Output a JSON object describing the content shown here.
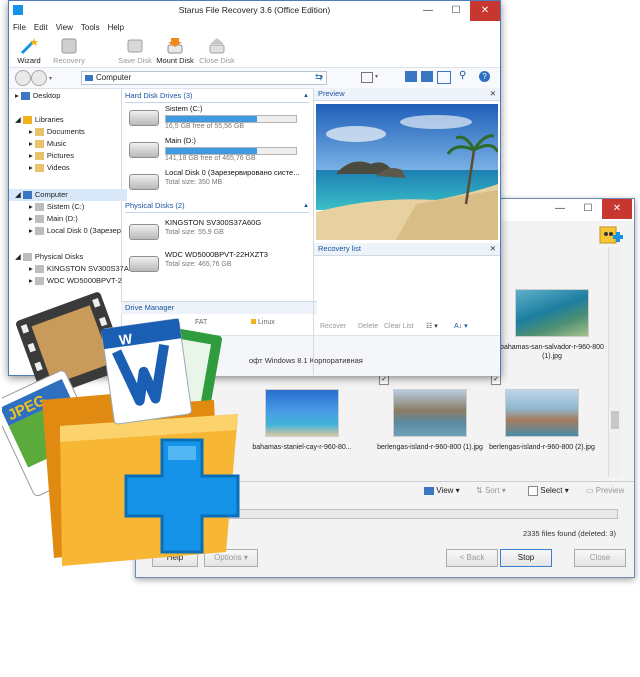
{
  "window": {
    "title": "Starus File Recovery 3.6 (Office Edition)",
    "controls": {
      "minimize": "—",
      "maximize": "☐",
      "close": "✕"
    }
  },
  "menu": [
    "File",
    "Edit",
    "View",
    "Tools",
    "Help"
  ],
  "toolbar": {
    "wizard": "Wizard",
    "recovery": "Recovery",
    "save_disk": "Save Disk",
    "mount_disk": "Mount Disk",
    "close_disk": "Close Disk"
  },
  "address": {
    "value": "Computer"
  },
  "tree": {
    "desktop": "Desktop",
    "libraries": "Libraries",
    "lib_items": [
      "Documents",
      "Music",
      "Pictures",
      "Videos"
    ],
    "computer": "Computer",
    "comp_items": [
      "Sistem (C:)",
      "Main (D:)",
      "Local Disk 0 (Зарезер"
    ],
    "physical": "Physical Disks",
    "phys_items": [
      "KINGSTON SV300S37A",
      "WDC WD5000BPVT-2"
    ]
  },
  "hard_disks": {
    "header": "Hard Disk Drives (3)",
    "items": [
      {
        "name": "Sistem (C:)",
        "sub": "16,5 GB free of 55,56 GB",
        "used_fraction": 0.7
      },
      {
        "name": "Main (D:)",
        "sub": "141,18 GB free of 465,76 GB",
        "used_fraction": 0.7
      },
      {
        "name": "Local Disk 0 (Зарезервировано систе...",
        "sub": "Total size: 350 MB"
      }
    ]
  },
  "physical_disks": {
    "header": "Physical Disks (2)",
    "items": [
      {
        "name": "KINGSTON SV300S37A60G",
        "sub": "Total size: 55,9 GB"
      },
      {
        "name": "WDC WD5000BPVT-22HXZT3",
        "sub": "Total size: 465,76 GB"
      }
    ]
  },
  "drive_manager": {
    "label": "Drive Manager",
    "fs1": "FAT",
    "fs2": "Linux"
  },
  "status_text": "офт Windows 8.1 Корпоративная",
  "preview": {
    "label": "Preview",
    "close": "✕"
  },
  "recovery_list": {
    "label": "Recovery list",
    "close": "✕",
    "recover": "Recover",
    "delete": "Delete",
    "clear_list": "Clear List"
  },
  "back_window": {
    "thumbs_top": [
      {
        "caption": "bahamas-san-salvador-r-960-800 (1).jpg"
      }
    ],
    "thumbs": [
      {
        "caption": "bahamas-staniel-cay-r-960-80..."
      },
      {
        "caption": "berlengas-island-r-960-800 (1).jpg"
      },
      {
        "caption": "berlengas-island-r-960-800 (2).jpg"
      }
    ],
    "view": "View",
    "sort": "Sort",
    "select": "Select",
    "preview": "Preview",
    "files_found": "2335 files found (deleted: 3)",
    "help": "Help",
    "options": "Options",
    "back": "< Back",
    "stop": "Stop",
    "close": "Close"
  },
  "logo": {
    "jpeg_label": "JPEG",
    "word_letter": "W"
  },
  "colors": {
    "accent": "#1a53a0",
    "logo_blue": "#1593e8",
    "folder": "#f2a21c"
  }
}
